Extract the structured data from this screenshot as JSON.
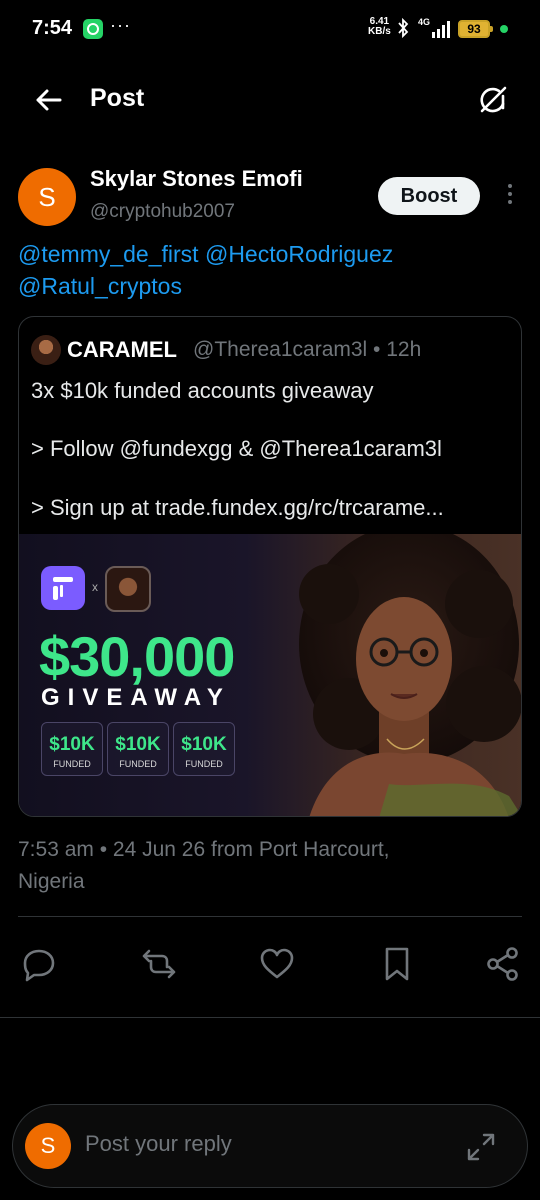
{
  "status_bar": {
    "time": "7:54",
    "dots": "···",
    "speed_value": "6.41",
    "speed_unit": "KB/s",
    "network": "4G",
    "battery": "93"
  },
  "header": {
    "title": "Post",
    "back_icon": "arrow-left-icon",
    "grok_icon": "grok-icon"
  },
  "post": {
    "author": {
      "avatar_letter": "S",
      "avatar_color": "#ef6c00",
      "name": "Skylar Stones Emofi",
      "handle": "@cryptohub2007"
    },
    "boost_label": "Boost",
    "mentions": [
      "@temmy_de_first",
      "@HectoRodriguez",
      "@Ratul_cryptos"
    ],
    "quote": {
      "name": "CARAMEL",
      "handle_time": "@Therea1caram3l • 12h",
      "lines": [
        "3x $10k funded accounts giveaway",
        "> Follow @fundexgg & @Therea1caram3l",
        "> Sign up at trade.fundex.gg/rc/trcarame..."
      ],
      "media": {
        "times": "x",
        "amount": "$30,000",
        "headline": "GIVEAWAY",
        "badges": [
          {
            "value": "$10K",
            "label": "FUNDED"
          },
          {
            "value": "$10K",
            "label": "FUNDED"
          },
          {
            "value": "$10K",
            "label": "FUNDED"
          }
        ],
        "accent_color": "#3ee68a"
      }
    },
    "timestamp_line1": "7:53 am • 24 Jun 26 from Port Harcourt,",
    "timestamp_line2": "Nigeria"
  },
  "actions": [
    "reply-icon",
    "repost-icon",
    "like-icon",
    "bookmark-icon",
    "share-icon"
  ],
  "reply": {
    "avatar_letter": "S",
    "placeholder": "Post your reply"
  },
  "colors": {
    "background": "#000000",
    "link": "#1d9bf0",
    "muted": "#71767b",
    "border": "#2f3336"
  }
}
